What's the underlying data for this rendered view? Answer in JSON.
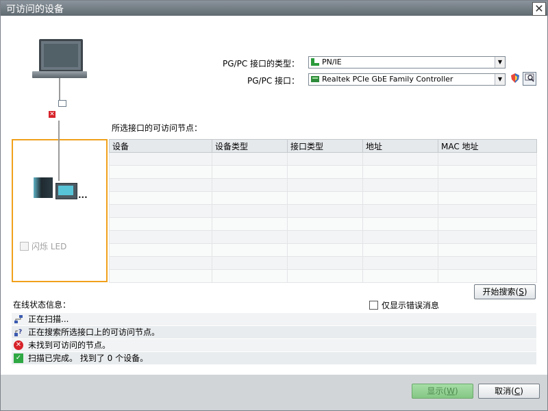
{
  "window": {
    "title": "可访问的设备",
    "close_glyph": "✕"
  },
  "interface": {
    "type_label": "PG/PC 接口的类型：",
    "type_value": "PN/IE",
    "iface_label": "PG/PC 接口：",
    "iface_value": "Realtek PCIe GbE Family Controller"
  },
  "left_panel": {
    "flash_led_label": "闪烁 LED"
  },
  "nodes": {
    "title": "所选接口的可访问节点：",
    "columns": [
      "设备",
      "设备类型",
      "接口类型",
      "地址",
      "MAC 地址"
    ],
    "rows": []
  },
  "search_button": {
    "label": "开始搜索",
    "accel": "S"
  },
  "status": {
    "title": "在线状态信息：",
    "errors_only_label": "仅显示错误消息",
    "messages": [
      {
        "icon": "network-scan-icon",
        "text": "正在扫描..."
      },
      {
        "icon": "network-search-icon",
        "text": "正在搜索所选接口上的可访问节点。"
      },
      {
        "icon": "error-icon",
        "text": "未找到可访问的节点。"
      },
      {
        "icon": "check-icon",
        "text": "扫描已完成。 找到了 0 个设备。"
      }
    ]
  },
  "footer": {
    "show_label": "显示",
    "show_accel": "W",
    "cancel_label": "取消",
    "cancel_accel": "C"
  },
  "colors": {
    "accent_orange": "#f0a01a",
    "ok_green": "#2fa844",
    "error_red": "#d7232a"
  }
}
